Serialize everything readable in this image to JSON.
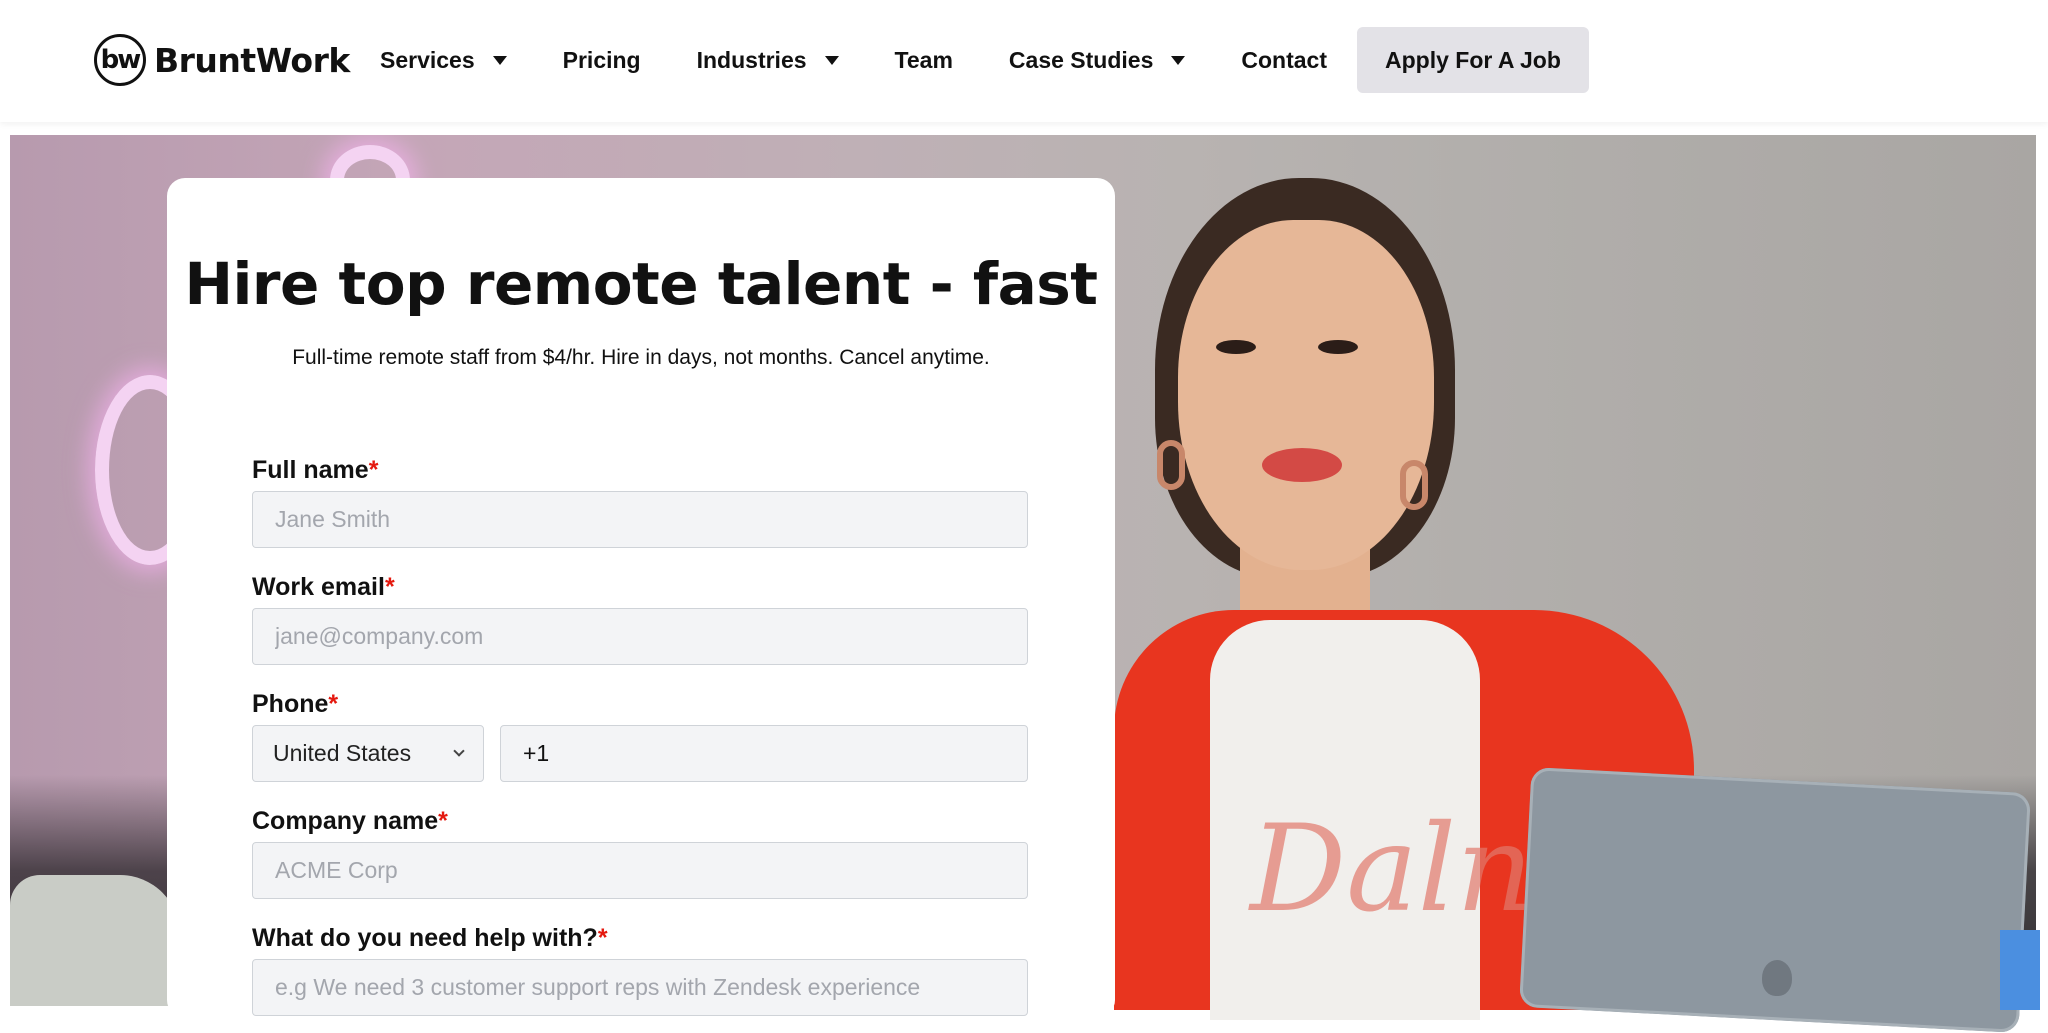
{
  "header": {
    "logo_mark": "bw",
    "logo_text": "BruntWork",
    "nav": [
      {
        "label": "Services",
        "has_dropdown": true
      },
      {
        "label": "Pricing",
        "has_dropdown": false
      },
      {
        "label": "Industries",
        "has_dropdown": true
      },
      {
        "label": "Team",
        "has_dropdown": false
      },
      {
        "label": "Case Studies",
        "has_dropdown": true
      },
      {
        "label": "Contact",
        "has_dropdown": false
      }
    ],
    "cta_label": "Apply For A Job"
  },
  "form": {
    "title": "Hire top remote talent - fast",
    "subtitle": "Full-time remote staff from $4/hr. Hire in days, not months. Cancel anytime.",
    "required_marker": "*",
    "fields": {
      "full_name": {
        "label": "Full name",
        "placeholder": "Jane Smith",
        "value": ""
      },
      "work_email": {
        "label": "Work email",
        "placeholder": "jane@company.com",
        "value": ""
      },
      "phone": {
        "label": "Phone",
        "country": "United States",
        "value": "+1"
      },
      "company_name": {
        "label": "Company name",
        "placeholder": "ACME Corp",
        "value": ""
      },
      "help": {
        "label": "What do you need help with?",
        "placeholder": "e.g We need 3 customer support reps with Zendesk experience",
        "value": ""
      }
    }
  },
  "hero": {
    "shirt_print": "Dalni"
  },
  "colors": {
    "required": "#e4190f",
    "cta_bg": "#e3e2e7",
    "input_bg": "#f3f4f6",
    "jacket": "#e8351f"
  }
}
